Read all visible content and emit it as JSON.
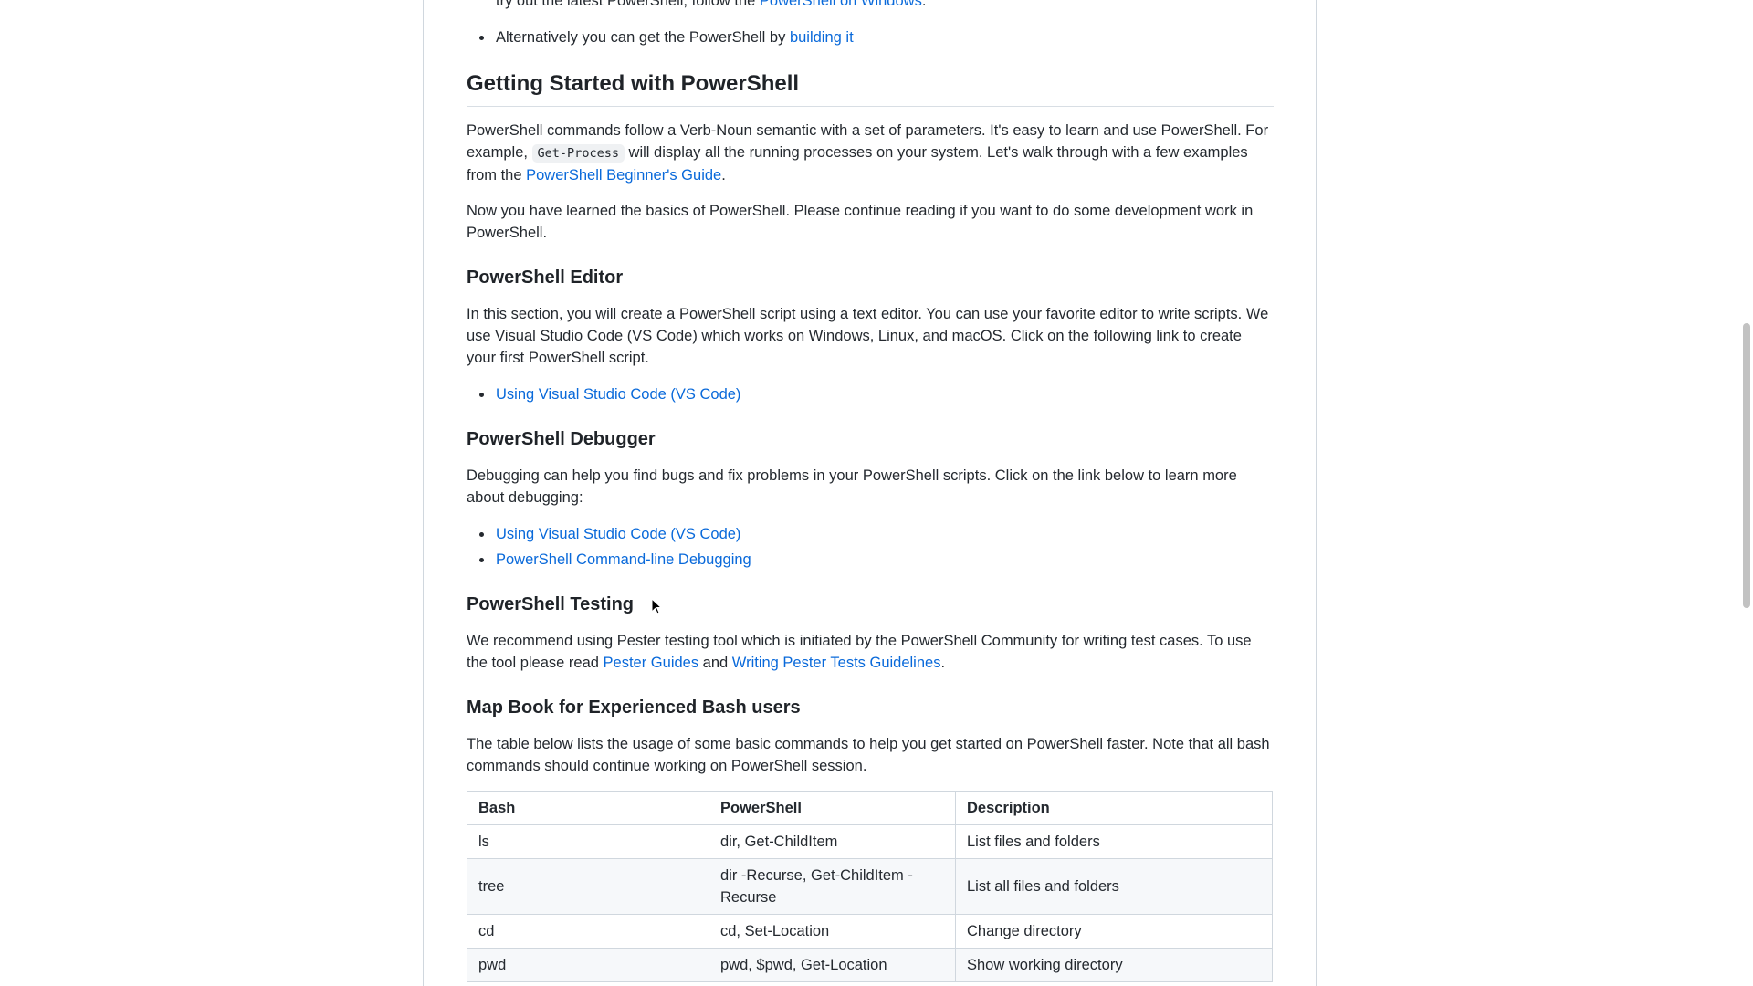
{
  "intro": {
    "partial_line_text": "try out the latest PowerShell, follow the ",
    "partial_line_link": "PowerShell on Windows",
    "partial_line_end": ".",
    "alt_text": "Alternatively you can get the PowerShell by ",
    "alt_link": "building it"
  },
  "getting_started": {
    "heading": "Getting Started with PowerShell",
    "p1_a": "PowerShell commands follow a Verb-Noun semantic with a set of parameters. It's easy to learn and use PowerShell. For example, ",
    "p1_code": "Get-Process",
    "p1_b": " will display all the running processes on your system. Let's walk through with a few examples from the ",
    "p1_link": "PowerShell Beginner's Guide",
    "p1_end": ".",
    "p2": "Now you have learned the basics of PowerShell. Please continue reading if you want to do some development work in PowerShell."
  },
  "editor": {
    "heading": "PowerShell Editor",
    "p": "In this section, you will create a PowerShell script using a text editor. You can use your favorite editor to write scripts. We use Visual Studio Code (VS Code) which works on Windows, Linux, and macOS. Click on the following link to create your first PowerShell script.",
    "links": [
      "Using Visual Studio Code (VS Code)"
    ]
  },
  "debugger": {
    "heading": "PowerShell Debugger",
    "p": "Debugging can help you find bugs and fix problems in your PowerShell scripts. Click on the link below to learn more about debugging:",
    "links": [
      "Using Visual Studio Code (VS Code)",
      "PowerShell Command-line Debugging"
    ]
  },
  "testing": {
    "heading": "PowerShell Testing",
    "p_a": "We recommend using Pester testing tool which is initiated by the PowerShell Community for writing test cases. To use the tool please read ",
    "link1": "Pester Guides",
    "p_mid": " and ",
    "link2": "Writing Pester Tests Guidelines",
    "p_end": "."
  },
  "mapbook": {
    "heading": "Map Book for Experienced Bash users",
    "p": "The table below lists the usage of some basic commands to help you get started on PowerShell faster. Note that all bash commands should continue working on PowerShell session.",
    "headers": [
      "Bash",
      "PowerShell",
      "Description"
    ],
    "rows": [
      [
        "ls",
        "dir, Get-ChildItem",
        "List files and folders"
      ],
      [
        "tree",
        "dir -Recurse, Get-ChildItem -Recurse",
        "List all files and folders"
      ],
      [
        "cd",
        "cd, Set-Location",
        "Change directory"
      ],
      [
        "pwd",
        "pwd, $pwd, Get-Location",
        "Show working directory"
      ]
    ]
  },
  "colors": {
    "link": "#0969da",
    "text": "#24292f",
    "border": "#d0d7de"
  }
}
